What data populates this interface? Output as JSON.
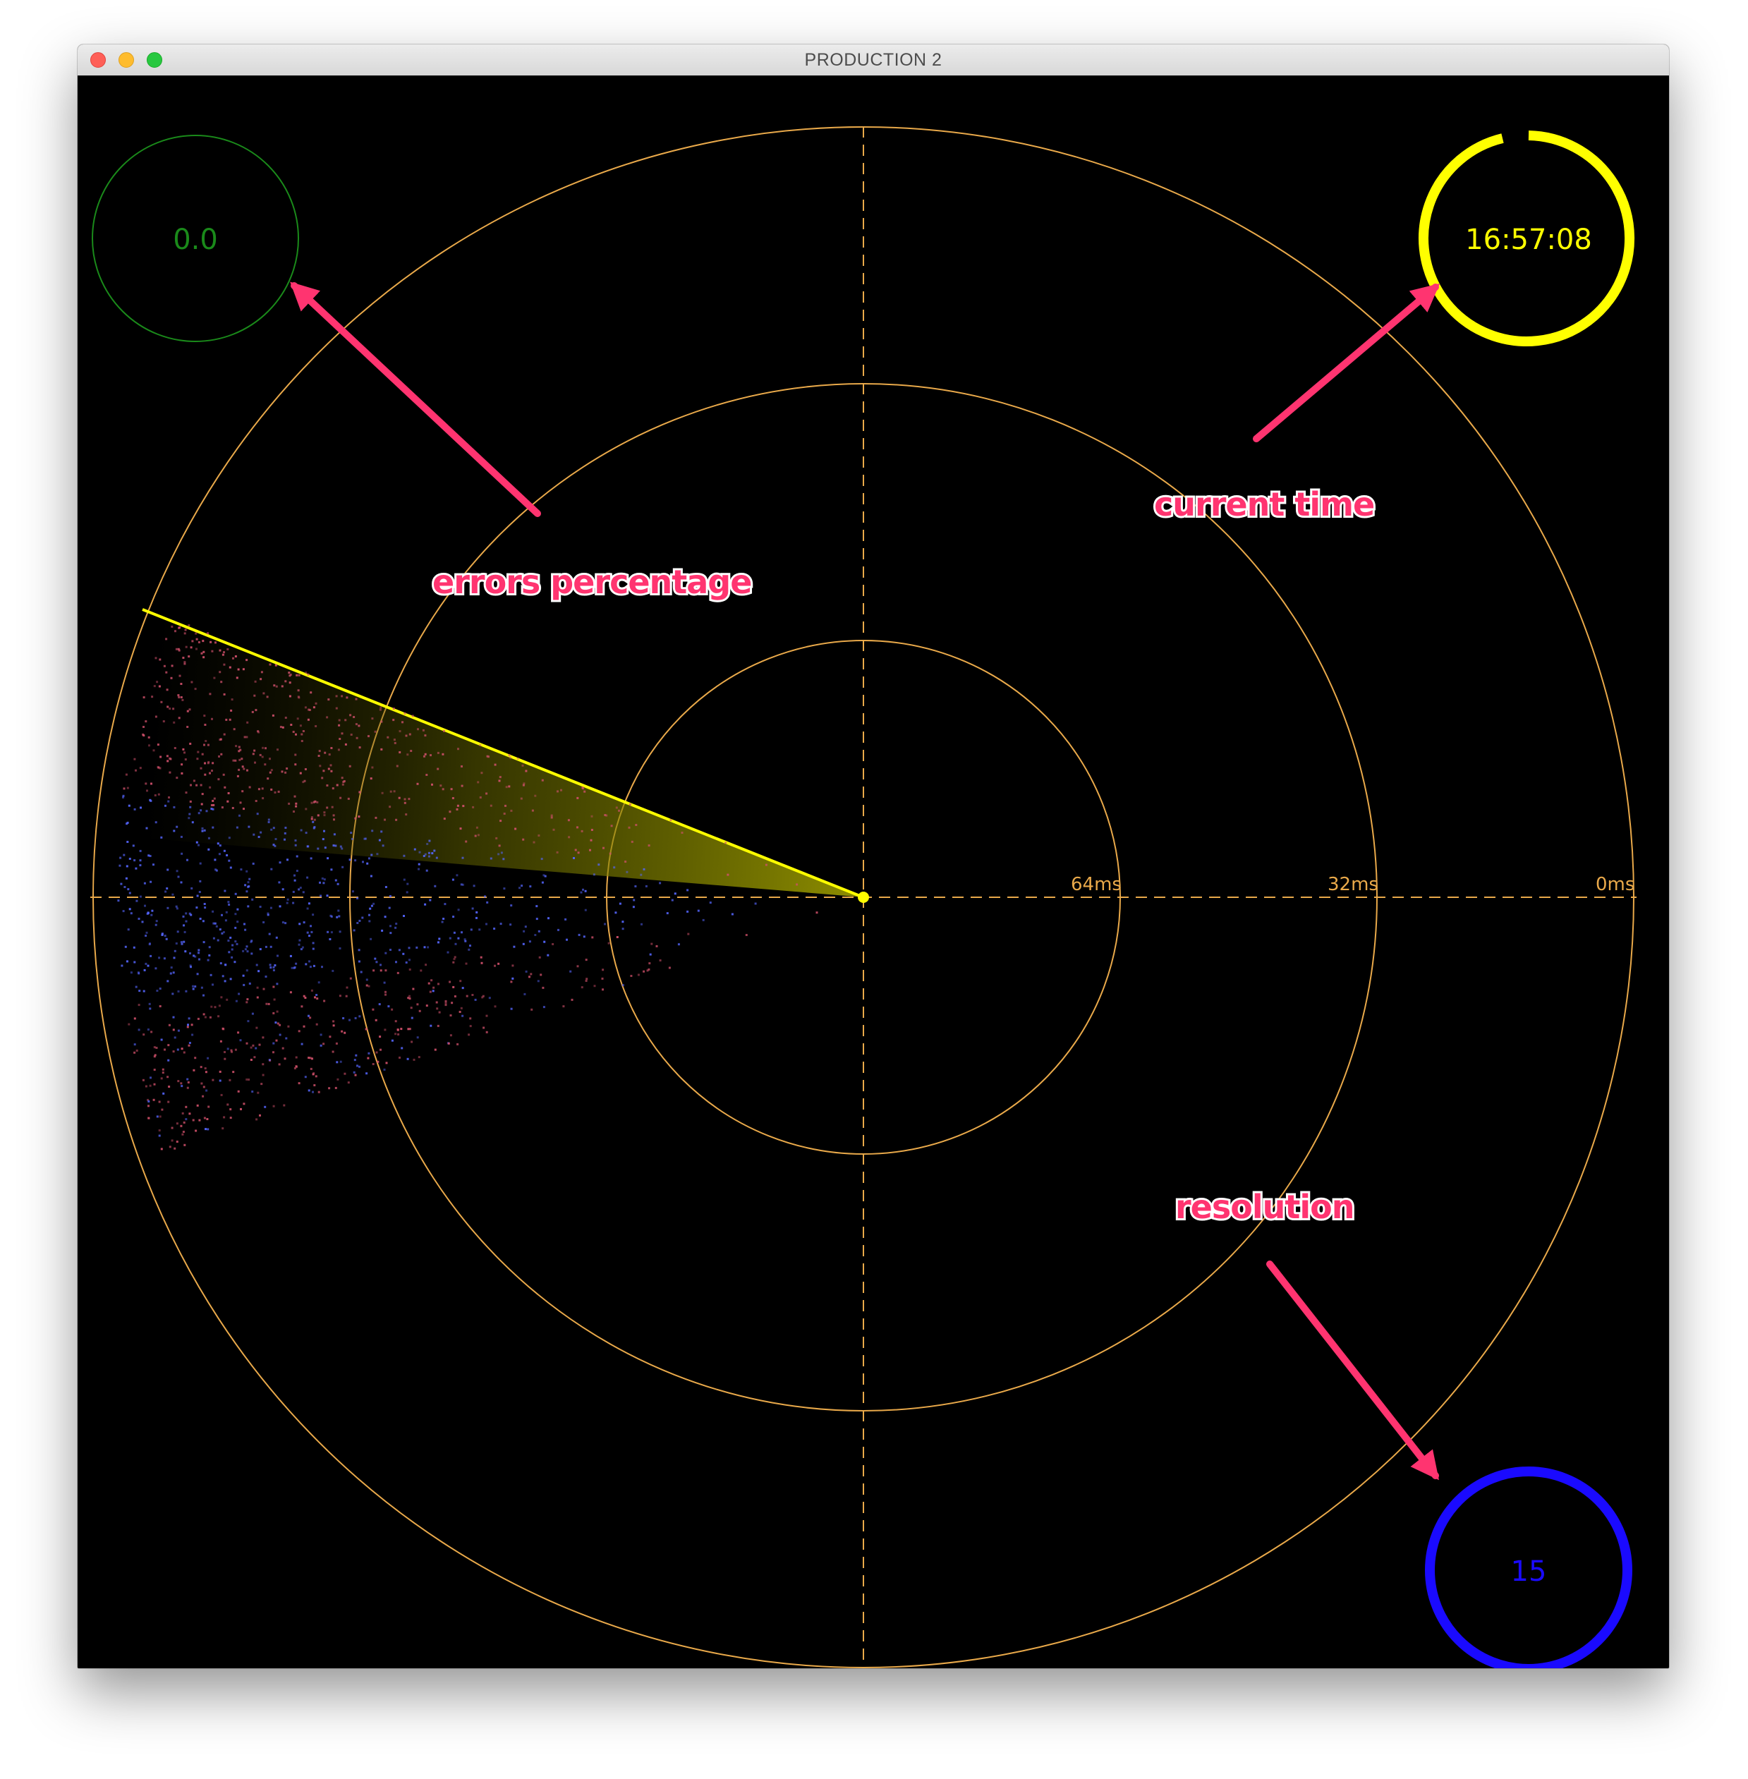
{
  "window": {
    "title": "PRODUCTION 2"
  },
  "radar": {
    "ring_labels": [
      "64ms",
      "32ms",
      "0ms"
    ],
    "colors": {
      "rings": "#e9a94a",
      "sweep": "#ffff00",
      "fast_points": "#5566ff",
      "slow_points": "#d0506a",
      "center_dot": "#ffff00"
    }
  },
  "gauges": {
    "errors": {
      "value": "0.0",
      "color": "#1a8a1a"
    },
    "time": {
      "value": "16:57:08",
      "color": "#ffff00"
    },
    "resolution": {
      "value": "15",
      "color": "#1a0aff"
    }
  },
  "annotations": {
    "errors_label": "errors percentage",
    "time_label": "current time",
    "resolution_label": "resolution",
    "color": "#ff3470"
  }
}
